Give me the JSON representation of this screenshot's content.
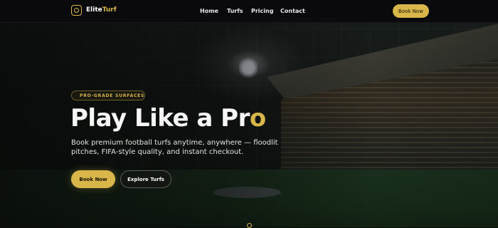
{
  "nav": {
    "brand_prefix": "Elite",
    "brand_suffix": "Turf",
    "links": [
      "Home",
      "Turfs",
      "Pricing",
      "Contact"
    ],
    "cta_label": "Book Now"
  },
  "hero": {
    "badge": "PRO-GRADE SURFACES",
    "headline_main": "Play Like a Pr",
    "headline_accent": "o",
    "subtext": "Book premium football turfs anytime, anywhere — floodlit pitches, FIFA-style quality, and instant checkout.",
    "primary_button": "Book Now",
    "secondary_button": "Explore Turfs"
  },
  "icons": {
    "logo": "target-icon",
    "scroll": "scroll-down-icon"
  },
  "colors": {
    "accent": "#d8b64a",
    "nav_bg": "#0a0a0c",
    "text": "#ffffff"
  }
}
